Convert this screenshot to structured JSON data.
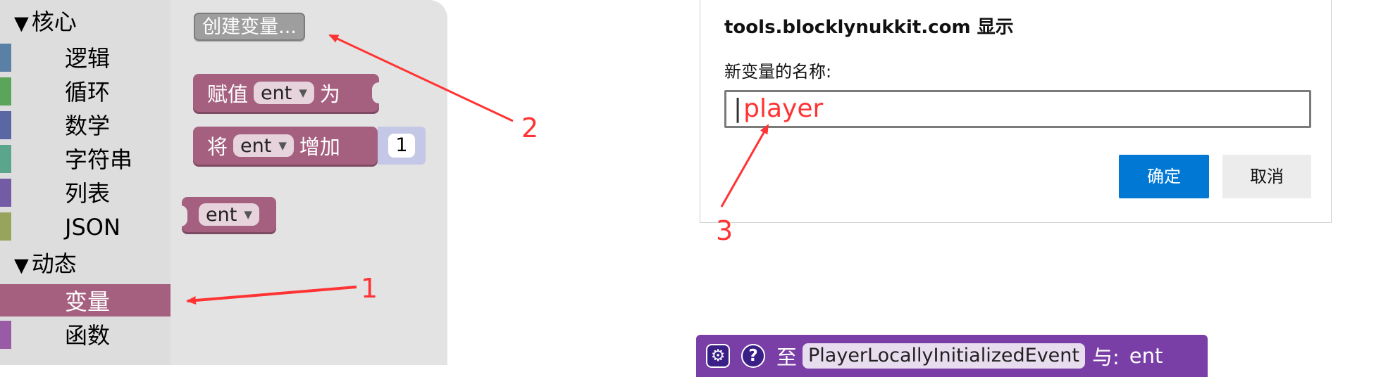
{
  "toolbox": {
    "groups": [
      {
        "label": "核心"
      },
      {
        "label": "动态"
      }
    ],
    "items": [
      {
        "label": "逻辑",
        "color": "#5b80a5"
      },
      {
        "label": "循环",
        "color": "#5ba55b"
      },
      {
        "label": "数学",
        "color": "#5b67a5"
      },
      {
        "label": "字符串",
        "color": "#5ba58c"
      },
      {
        "label": "列表",
        "color": "#745ba5"
      },
      {
        "label": "JSON",
        "color": "#96a55b"
      },
      {
        "label": "变量",
        "color": "#a5607f"
      },
      {
        "label": "函数",
        "color": "#995ba5"
      }
    ]
  },
  "flyout": {
    "create_variable_button": "创建变量...",
    "set_block": {
      "prefix": "赋值",
      "var": "ent",
      "suffix": "为"
    },
    "change_block": {
      "prefix": "将",
      "var": "ent",
      "suffix": "增加",
      "value": "1"
    },
    "getter_block": {
      "var": "ent"
    },
    "dropdown_arrow": "▼"
  },
  "dialog": {
    "title": "tools.blocklynukkit.com 显示",
    "prompt": "新变量的名称:",
    "input_value": "player",
    "ok_label": "确定",
    "cancel_label": "取消"
  },
  "event_block": {
    "icons": [
      "gear-icon",
      "help-icon"
    ],
    "help_glyph": "?",
    "gear_glyph": "⚙",
    "to_label": "至",
    "event_name": "PlayerLocallyInitializedEvent",
    "with_label": "与:",
    "param": "ent"
  },
  "annotations": [
    "1",
    "2",
    "3"
  ],
  "colors": {
    "variable_category": "#a5607f",
    "ok_button": "#0078d4",
    "annotation": "#ff3333",
    "event_block": "#7a3fa6"
  }
}
